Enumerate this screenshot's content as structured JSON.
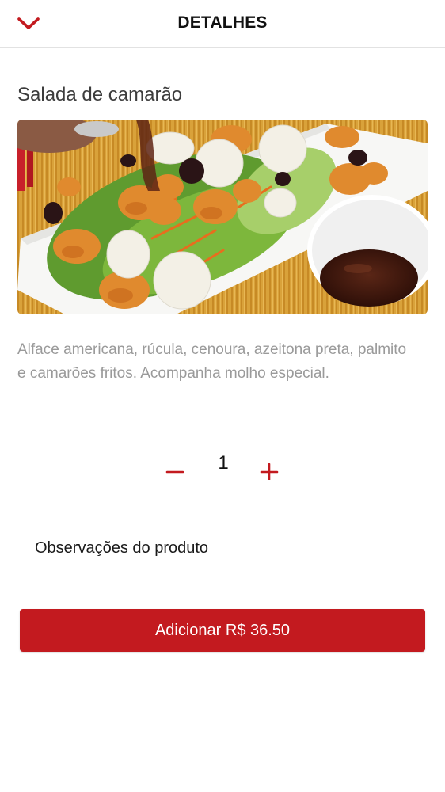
{
  "colors": {
    "accent": "#c31a1f",
    "description_text": "#9a9a9a",
    "title_text": "#3d3d3d"
  },
  "header": {
    "title": "DETALHES",
    "back_icon": "chevron-down-icon"
  },
  "product": {
    "name": "Salada de camarão",
    "image_alt": "Salada de camarão",
    "description": "Alface americana, rúcula, cenoura, azeitona preta, palmito e camarões fritos. Acompanha molho especial."
  },
  "quantity": {
    "value": "1",
    "minus_icon": "minus-icon",
    "plus_icon": "plus-icon"
  },
  "notes": {
    "placeholder": "Observações do produto",
    "value": ""
  },
  "cta": {
    "label": "Adicionar R$ 36.50"
  }
}
